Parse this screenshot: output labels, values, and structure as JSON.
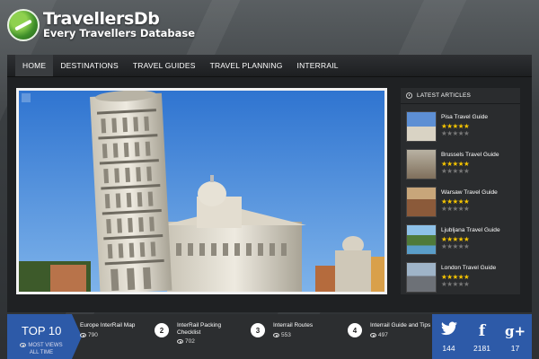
{
  "brand": {
    "title": "TravellersDb",
    "subtitle": "Every Travellers Database"
  },
  "nav": {
    "items": [
      {
        "label": "HOME"
      },
      {
        "label": "DESTINATIONS"
      },
      {
        "label": "TRAVEL GUIDES"
      },
      {
        "label": "TRAVEL PLANNING"
      },
      {
        "label": "INTERRAIL"
      }
    ]
  },
  "latest": {
    "heading": "LATEST ARTICLES",
    "articles": [
      {
        "title": "Pisa Travel Guide",
        "rating": 5
      },
      {
        "title": "Brussels Travel Guide",
        "rating": 5
      },
      {
        "title": "Warsaw Travel Guide",
        "rating": 5
      },
      {
        "title": "Ljubljana Travel Guide",
        "rating": 5
      },
      {
        "title": "London Travel Guide",
        "rating": 5
      }
    ]
  },
  "top10": {
    "title": "TOP 10",
    "sub_line1": "MOST VIEWS",
    "sub_line2": "ALL TIME",
    "items": [
      {
        "number": "",
        "title": "Europe InterRail Map",
        "title2": "",
        "views": "790"
      },
      {
        "number": "2",
        "title": "InterRail Packing",
        "title2": "Checklist",
        "views": "702"
      },
      {
        "number": "3",
        "title": "Interrail Routes",
        "title2": "",
        "views": "553"
      },
      {
        "number": "4",
        "title": "Interrail Guide and Tips",
        "title2": "",
        "views": "497"
      }
    ]
  },
  "social": {
    "twitter": {
      "icon": "twitter-icon",
      "count": "144"
    },
    "facebook": {
      "icon": "facebook-icon",
      "count": "2181"
    },
    "googleplus": {
      "icon": "google-plus-icon",
      "count": "17"
    }
  },
  "colors": {
    "accent_blue": "#2d5aa8",
    "star_gold": "#f5c400",
    "panel_dark": "#1f2123"
  }
}
